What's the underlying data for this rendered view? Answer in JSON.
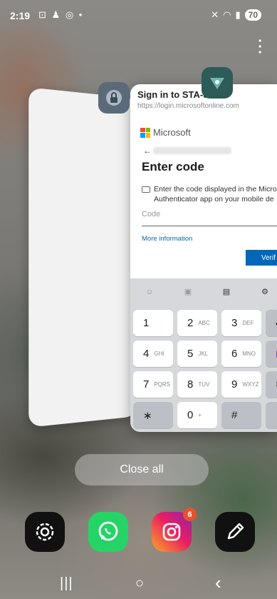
{
  "status_bar": {
    "time": "2:19",
    "left_icons": [
      "screenshot-icon",
      "snapchat-icon",
      "instagram-icon",
      "dot-icon"
    ],
    "right_icons": [
      "mute-icon",
      "wifi-icon",
      "signal-icon"
    ],
    "battery": "70"
  },
  "recents": {
    "main_card": {
      "title": "Sign in to STA-Staff",
      "url": "https://login.microsoftonline.com",
      "brand": "Microsoft",
      "heading": "Enter code",
      "instruction_line1": "Enter the code displayed in the Micro",
      "instruction_line2": "Authenticator app on your mobile de",
      "code_placeholder": "Code",
      "more_info": "More information",
      "verify_label": "Verif"
    },
    "keyboard": {
      "keys": [
        {
          "n": "1",
          "l": ""
        },
        {
          "n": "2",
          "l": "ABC"
        },
        {
          "n": "3",
          "l": "DEF"
        },
        {
          "n": "4",
          "l": "GHI"
        },
        {
          "n": "5",
          "l": "JKL"
        },
        {
          "n": "6",
          "l": "MNO"
        },
        {
          "n": "7",
          "l": "PQRS"
        },
        {
          "n": "8",
          "l": "TUV"
        },
        {
          "n": "9",
          "l": "WXYZ"
        },
        {
          "n": "∗",
          "l": ""
        },
        {
          "n": "0",
          "l": "+"
        },
        {
          "n": "#",
          "l": ""
        }
      ],
      "side_keys": [
        "•",
        "N",
        "✱",
        ""
      ]
    }
  },
  "close_all_label": "Close all",
  "dock": {
    "apps": [
      "settings-icon",
      "whatsapp-icon",
      "instagram-icon",
      "notes-pen-icon"
    ],
    "instagram_badge": "6"
  },
  "nav": {
    "recent": "|||",
    "home": "○",
    "back": "‹"
  }
}
